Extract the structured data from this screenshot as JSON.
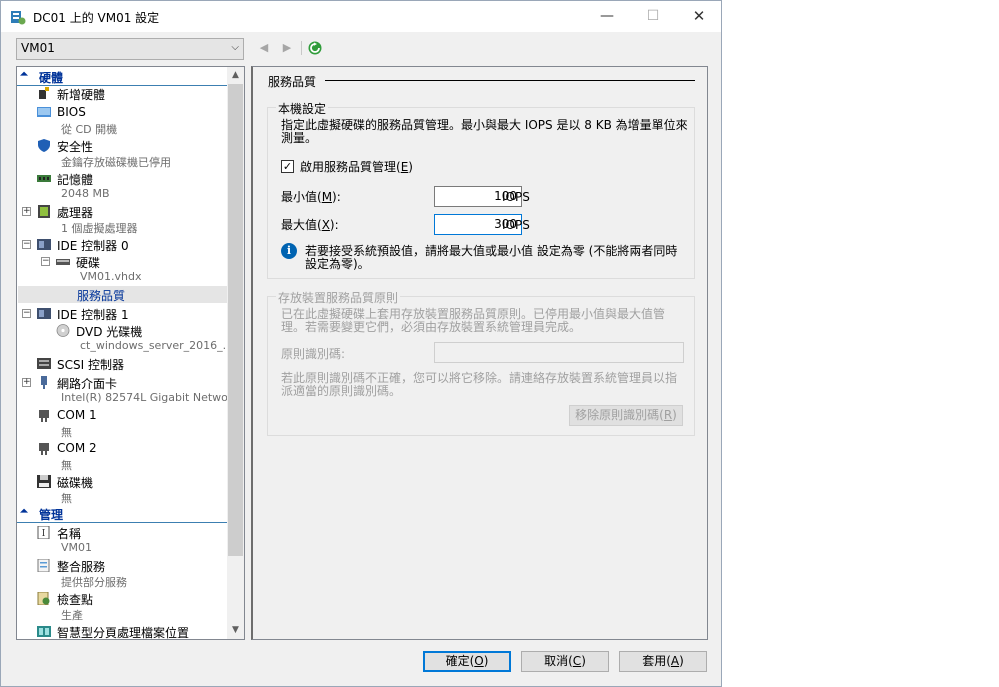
{
  "window": {
    "title": "DC01 上的 VM01 設定",
    "min": "—",
    "max": "☐",
    "close": "✕"
  },
  "toolbar": {
    "vm_selected": "VM01"
  },
  "tree": {
    "hardware_label": "硬體",
    "management_label": "管理",
    "items": {
      "add_hardware": "新增硬體",
      "bios": "BIOS",
      "bios_sub": "從 CD 開機",
      "security": "安全性",
      "security_sub": "金鑰存放磁碟機已停用",
      "memory": "記憶體",
      "memory_sub": "2048 MB",
      "processor": "處理器",
      "processor_sub": "1 個虛擬處理器",
      "ide0": "IDE 控制器 0",
      "hdd": "硬碟",
      "hdd_sub": "VM01.vhdx",
      "qos": "服務品質",
      "ide1": "IDE 控制器 1",
      "dvd": "DVD 光碟機",
      "dvd_sub": "ct_windows_server_2016_...",
      "scsi": "SCSI 控制器",
      "nic": "網路介面卡",
      "nic_sub": "Intel(R) 82574L Gigabit Networ...",
      "com1": "COM 1",
      "com1_sub": "無",
      "com2": "COM 2",
      "com2_sub": "無",
      "floppy": "磁碟機",
      "floppy_sub": "無",
      "name": "名稱",
      "name_sub": "VM01",
      "integration": "整合服務",
      "integration_sub": "提供部分服務",
      "checkpoint": "檢查點",
      "checkpoint_sub": "生產",
      "smart_paging": "智慧型分頁處理檔案位置"
    }
  },
  "panel": {
    "title": "服務品質",
    "local": {
      "title": "本機設定",
      "desc_line1": "指定此虛擬硬碟的服務品質管理。最小與最大 IOPS 是以 8 KB 為增量單位來",
      "desc_line2": "測量。",
      "enable_pre": "啟用服務品質管理(",
      "enable_key": "E",
      "enable_post": ")",
      "min_pre": "最小值(",
      "min_key": "M",
      "min_post": "):",
      "min_value": "100",
      "max_pre": "最大值(",
      "max_key": "X",
      "max_post": "):",
      "max_value": "300",
      "unit": "IOPS",
      "info_line1": "若要接受系統預設值，請將最大值或最小值 設定為零 (不能將兩者同時",
      "info_line2": "設定為零)。"
    },
    "policy": {
      "title": "存放裝置服務品質原則",
      "desc_line1": "已在此虛擬硬碟上套用存放裝置服務品質原則。已停用最小值與最大值管",
      "desc_line2": "理。若需要變更它們，必須由存放裝置系統管理員完成。",
      "id_label": "原則識別碼:",
      "warn_line1": "若此原則識別碼不正確，您可以將它移除。請連絡存放裝置系統管理員以指",
      "warn_line2": "派適當的原則識別碼。",
      "remove_pre": "移除原則識別碼(",
      "remove_key": "R",
      "remove_post": ")"
    }
  },
  "buttons": {
    "ok_pre": "確定(",
    "ok_key": "O",
    "ok_post": ")",
    "cancel_pre": "取消(",
    "cancel_key": "C",
    "cancel_post": ")",
    "apply_pre": "套用(",
    "apply_key": "A",
    "apply_post": ")"
  },
  "colors": {
    "accent": "#0078d7",
    "category": "#003399",
    "info": "#0063b1"
  }
}
